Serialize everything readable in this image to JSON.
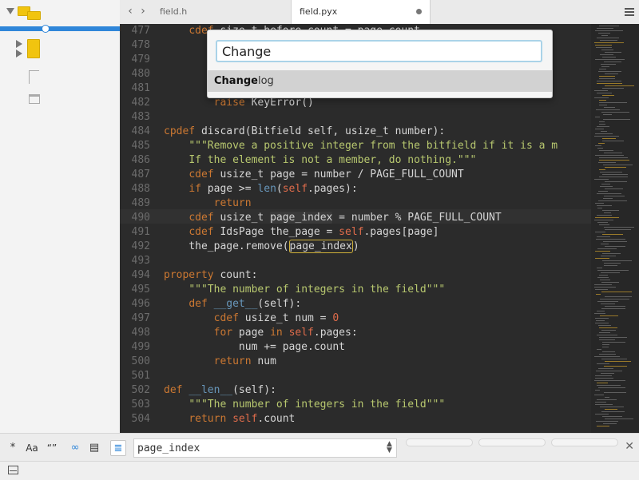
{
  "tabs": [
    {
      "label": "field.h",
      "active": false,
      "modified": false
    },
    {
      "label": "field.pyx",
      "active": true,
      "modified": true
    }
  ],
  "goto_anything": {
    "query": "Change",
    "result": {
      "match": "Change",
      "rest": "log"
    }
  },
  "code": [
    {
      "ln": "477",
      "html": "    <span class='kw'>cdef</span> size_t before_count = page_count"
    },
    {
      "ln": "478",
      "html": ""
    },
    {
      "ln": "479",
      "html": ""
    },
    {
      "ln": "480",
      "html": ""
    },
    {
      "ln": "481",
      "html": ""
    },
    {
      "ln": "482",
      "html": "        <span class='kw'>raise</span> KeyError()"
    },
    {
      "ln": "483",
      "html": ""
    },
    {
      "ln": "484",
      "html": "<span class='kw'>cpdef</span> discard(Bitfield self, usize_t number):"
    },
    {
      "ln": "485",
      "html": "    <span class='str'>\"\"\"Remove a positive integer from the bitfield if it is a m</span>"
    },
    {
      "ln": "486",
      "html": "    <span class='str'>If the element is not a member, do nothing.\"\"\"</span>"
    },
    {
      "ln": "487",
      "html": "    <span class='kw'>cdef</span> usize_t page = number / PAGE_FULL_COUNT"
    },
    {
      "ln": "488",
      "html": "    <span class='kw'>if</span> page &gt;= <span class='kw2'>len</span>(<span class='self'>self</span>.pages):"
    },
    {
      "ln": "489",
      "html": "        <span class='kw'>return</span>"
    },
    {
      "ln": "490",
      "html": "    <span class='kw'>cdef</span> usize_t <span class='box2'>page_index</span> = number % PAGE_FULL_COUNT"
    },
    {
      "ln": "491",
      "html": "    <span class='kw'>cdef</span> IdsPage the_page = <span class='self'>self</span>.pages[page]"
    },
    {
      "ln": "492",
      "html": "    the_page.remove(<span class='box1'>page_index</span>)"
    },
    {
      "ln": "493",
      "html": ""
    },
    {
      "ln": "494",
      "html": "<span class='kw'>property</span> count:"
    },
    {
      "ln": "495",
      "html": "    <span class='str'>\"\"\"The number of integers in the field\"\"\"</span>"
    },
    {
      "ln": "496",
      "html": "    <span class='kw'>def</span> <span class='kw2'>__get__</span>(self):"
    },
    {
      "ln": "497",
      "html": "        <span class='kw'>cdef</span> usize_t num = <span class='num'>0</span>"
    },
    {
      "ln": "498",
      "html": "        <span class='kw'>for</span> page <span class='kw'>in</span> <span class='self'>self</span>.pages:"
    },
    {
      "ln": "499",
      "html": "            num += page.count"
    },
    {
      "ln": "500",
      "html": "        <span class='kw'>return</span> num"
    },
    {
      "ln": "501",
      "html": ""
    },
    {
      "ln": "502",
      "html": "<span class='kw'>def</span> <span class='kw2'>__len__</span>(self):"
    },
    {
      "ln": "503",
      "html": "    <span class='str'>\"\"\"The number of integers in the field\"\"\"</span>"
    },
    {
      "ln": "504",
      "html": "    <span class='kw'>return</span> <span class='self'>self</span>.count"
    }
  ],
  "find_bar": {
    "regex_label": "*",
    "case_label": "Aa",
    "word_label": "“”",
    "query": "page_index"
  },
  "colors": {
    "accent": "#2f86d9",
    "editor_bg": "#2b2b2b",
    "keyword": "#cc7832",
    "string": "#b8c86f"
  }
}
